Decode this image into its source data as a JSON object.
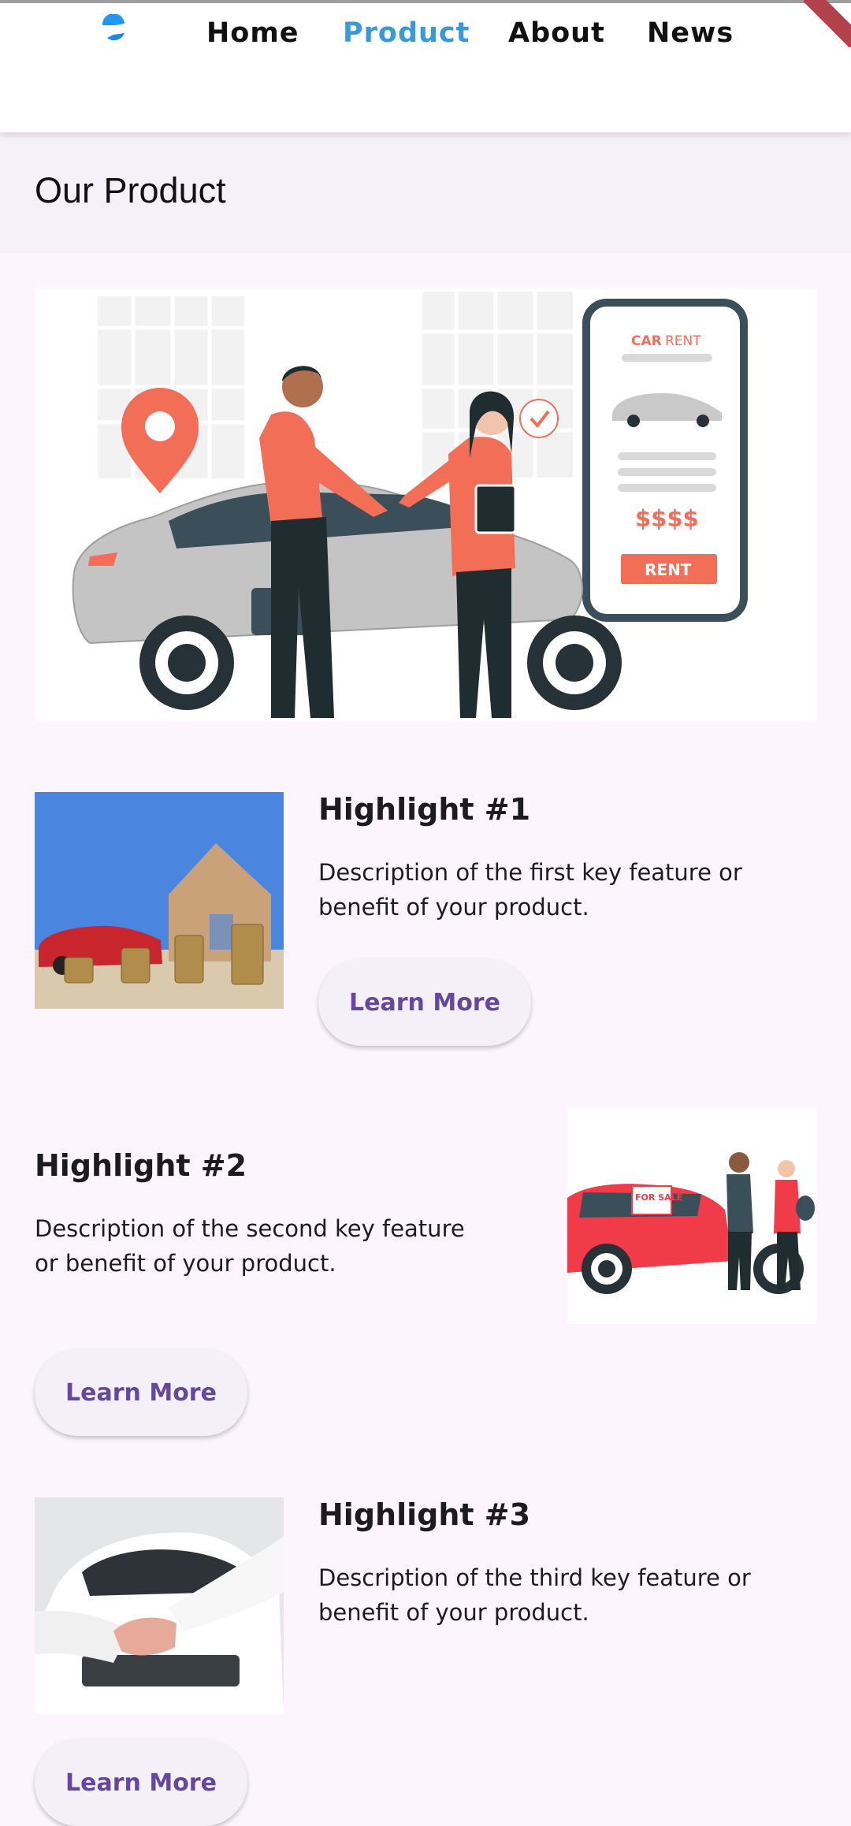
{
  "nav": {
    "items": [
      {
        "label": "Home",
        "active": false
      },
      {
        "label": "Product",
        "active": true
      },
      {
        "label": "About",
        "active": false
      },
      {
        "label": "News",
        "active": false
      }
    ],
    "active_color": "#3a9ad9"
  },
  "page": {
    "title": "Our Product"
  },
  "hero": {
    "illustration": "car-rental-illustration",
    "phone_header_bold": "CAR",
    "phone_header_rest": " RENT",
    "phone_price": "$$$$",
    "phone_button": "RENT"
  },
  "highlights": [
    {
      "title": "Highlight #1",
      "description": "Description of the first key feature or benefit of your product.",
      "button": "Learn More",
      "image": "car-coins-house-photo"
    },
    {
      "title": "Highlight #2",
      "description": "Description of the second key feature or benefit of your product.",
      "button": "Learn More",
      "image": "car-for-sale-illustration",
      "image_sign": "FOR SALE"
    },
    {
      "title": "Highlight #3",
      "description": "Description of the third key feature or benefit of your product.",
      "button": "Learn More",
      "image": "handshake-car-photo"
    }
  ],
  "colors": {
    "accent": "#3a9ad9",
    "button_text": "#65489e",
    "illustration": "#f26e57"
  }
}
